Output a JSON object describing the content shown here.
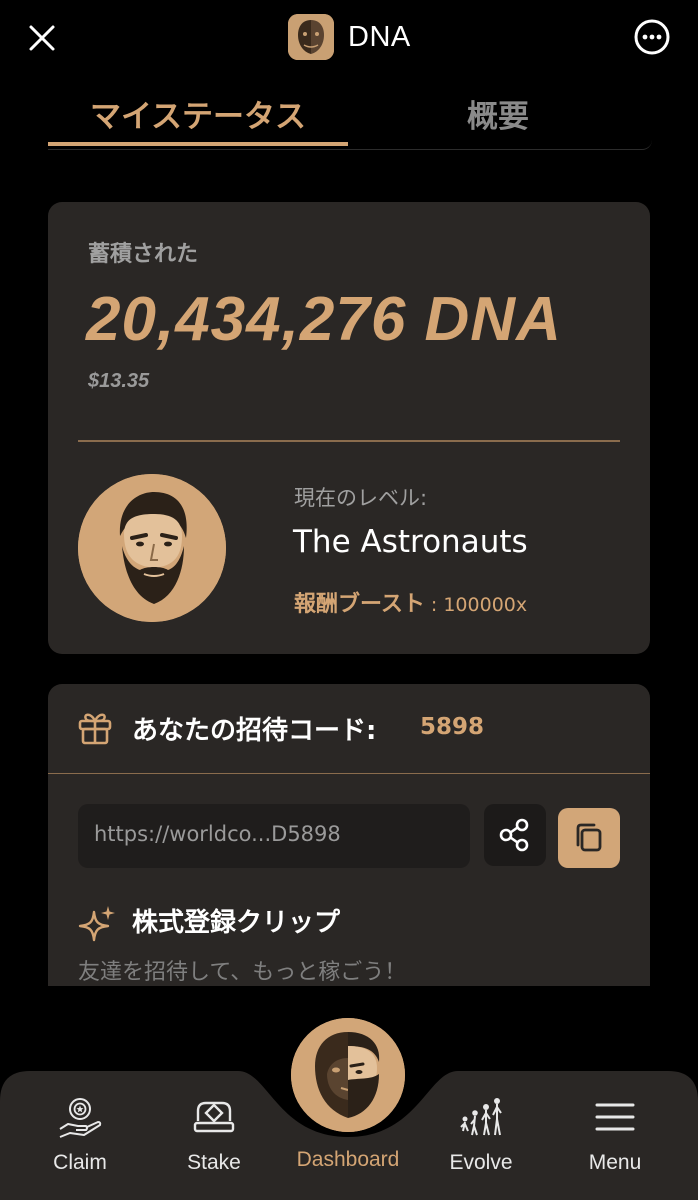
{
  "header": {
    "title": "DNA",
    "close_icon": "close-icon",
    "more_icon": "more-options-icon"
  },
  "tabs": [
    {
      "label": "マイステータス",
      "active": true
    },
    {
      "label": "概要",
      "active": false
    }
  ],
  "balance": {
    "label": "蓄積された",
    "amount": "20,434,276 DNA",
    "usd": "$13.35"
  },
  "level": {
    "label": "現在のレベル:",
    "name": "The Astronauts",
    "boost_label": "報酬ブースト",
    "boost_value": ": 100000x"
  },
  "invite": {
    "title": "あなたの招待コード:",
    "code": "5898",
    "link": "https://worldco...D5898",
    "stock_title": "株式登録クリップ",
    "stock_desc": "友達を招待して、もっと稼ごう！"
  },
  "nav": {
    "items": [
      {
        "label": "Claim",
        "icon": "claim-award-icon"
      },
      {
        "label": "Stake",
        "icon": "stake-icon"
      },
      {
        "label": "Dashboard",
        "icon": "dashboard-face-icon",
        "active": true
      },
      {
        "label": "Evolve",
        "icon": "evolve-icon"
      },
      {
        "label": "Menu",
        "icon": "menu-hamburger-icon"
      }
    ]
  },
  "colors": {
    "accent": "#d4a574",
    "card_bg": "#2a2725",
    "background": "#000000"
  }
}
